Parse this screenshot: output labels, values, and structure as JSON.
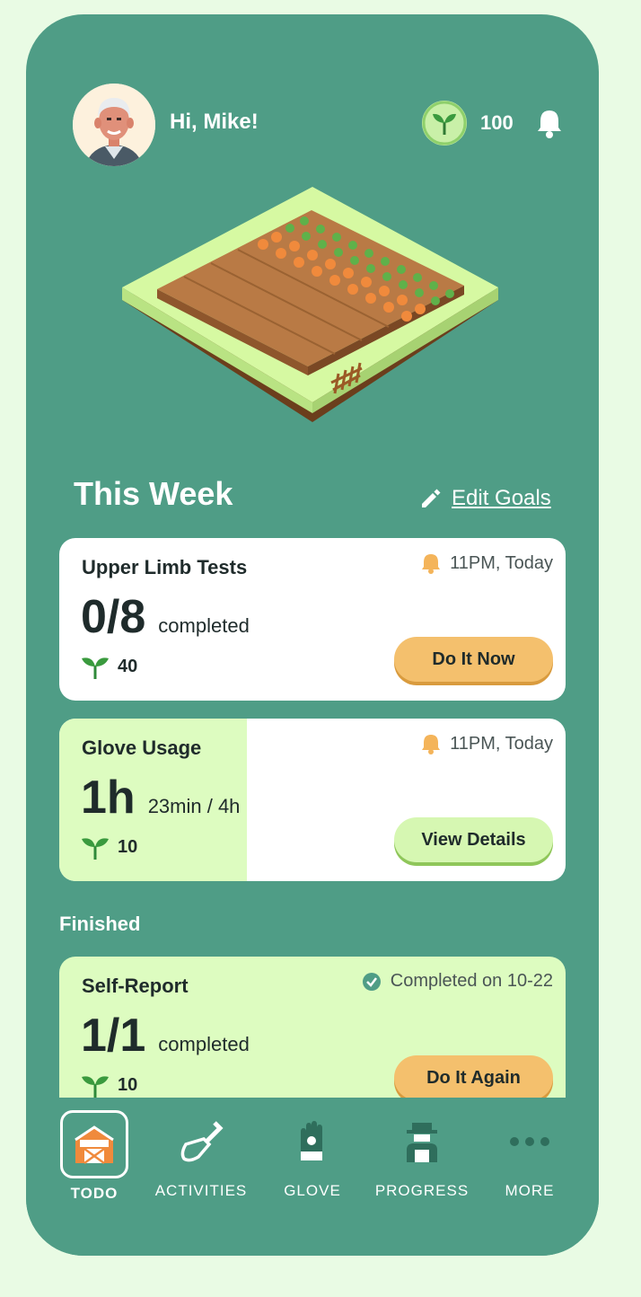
{
  "header": {
    "greeting": "Hi, Mike!",
    "points": "100"
  },
  "week": {
    "title": "This Week",
    "edit_label": "Edit Goals"
  },
  "tasks": [
    {
      "title": "Upper Limb Tests",
      "due": "11PM, Today",
      "big": "0/8",
      "sub": "completed",
      "reward": "40",
      "button": "Do It Now",
      "progress": 0
    },
    {
      "title": "Glove Usage",
      "due": "11PM, Today",
      "big": "1h",
      "sub": "23min / 4h",
      "reward": "10",
      "button": "View Details",
      "progress": 0.37
    }
  ],
  "finished": {
    "label": "Finished",
    "task": {
      "title": "Self-Report",
      "status": "Completed on 10-22",
      "big": "1/1",
      "sub": "completed",
      "reward": "10",
      "button": "Do It Again"
    }
  },
  "nav": [
    {
      "label": "TODO",
      "icon": "barn-icon",
      "active": true
    },
    {
      "label": "ACTIVITIES",
      "icon": "shovel-icon",
      "active": false
    },
    {
      "label": "GLOVE",
      "icon": "glove-icon",
      "active": false
    },
    {
      "label": "PROGRESS",
      "icon": "farmer-icon",
      "active": false
    },
    {
      "label": "MORE",
      "icon": "more-dots-icon",
      "active": false
    }
  ],
  "colors": {
    "background": "#4f9d86",
    "page": "#e9fbe4",
    "card_done": "#ddfcc0",
    "accent_orange": "#f4c06d",
    "accent_lime": "#d6f7b2"
  }
}
